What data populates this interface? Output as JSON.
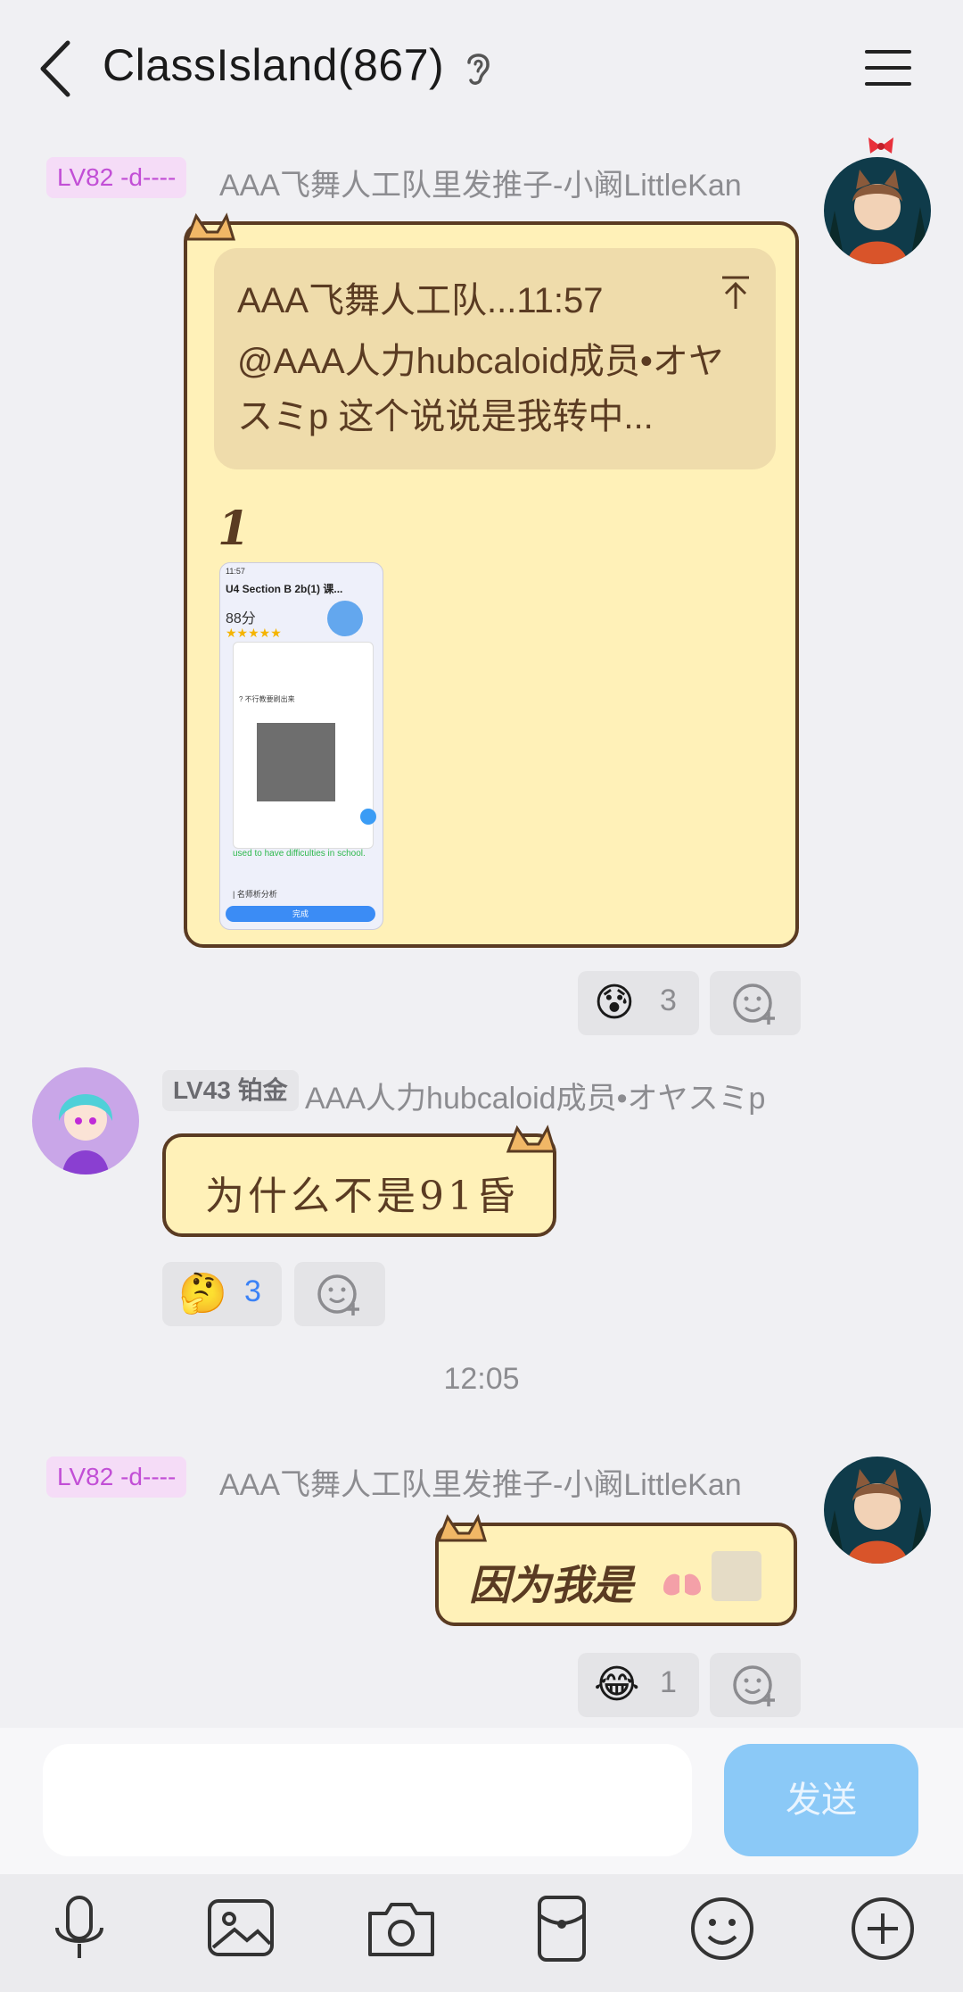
{
  "header": {
    "title": "ClassIsland(867)",
    "back_icon": "chevron-left-icon",
    "ear_icon": "ear-icon",
    "menu_icon": "hamburger-menu-icon"
  },
  "messages": [
    {
      "badge": "LV82 -d----",
      "sender": "AAA飞舞人工队里发推子-小阚LittleKan",
      "quote_head": "AAA飞舞人工队...11:57",
      "quote_text": "@AAA人力hubcaloid成员•オヤスミp 这个说说是我转中...",
      "body_text": "1",
      "reaction_emoji": "😰",
      "reaction_count": "3"
    },
    {
      "badge": "LV43 铂金",
      "sender": "AAA人力hubcaloid成员•オヤスミp",
      "body_text": "为什么不是91昏",
      "reaction_emoji": "🤔",
      "reaction_count": "3"
    },
    {
      "timestamp": "12:05"
    },
    {
      "badge": "LV82 -d----",
      "sender": "AAA飞舞人工队里发推子-小阚LittleKan",
      "body_text": "因为我是",
      "reaction_emoji": "😂",
      "reaction_count": "1"
    }
  ],
  "screenshot_preview": {
    "time": "11:57",
    "title": "U4 Section B 2b(1) 课...",
    "score": "88分",
    "line1": "? 不行教要刷出来",
    "green_text": "used to have difficulties in school.",
    "section": "| 名师析分析",
    "done_button": "完成"
  },
  "input": {
    "placeholder": "",
    "send_label": "发送"
  },
  "toolbar": [
    "microphone-icon",
    "image-icon",
    "camera-icon",
    "red-packet-icon",
    "emoji-icon",
    "plus-icon"
  ],
  "colors": {
    "bubble_fill": "#fff1b8",
    "bubble_border": "#5a3b22",
    "badge_pink": "#c24fd6",
    "send_button": "#8bc9f7"
  }
}
